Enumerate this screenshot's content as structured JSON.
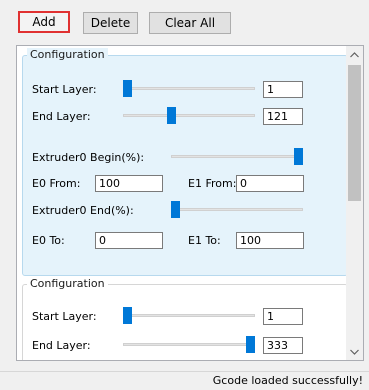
{
  "toolbar": {
    "add_label": "Add",
    "delete_label": "Delete",
    "clear_all_label": "Clear All"
  },
  "configurations": [
    {
      "title": "Configuration",
      "selected": true,
      "start_layer_label": "Start Layer:",
      "start_layer_value": "1",
      "start_layer_slider_fraction": 0.0,
      "end_layer_label": "End Layer:",
      "end_layer_value": "121",
      "end_layer_slider_fraction": 0.36,
      "extruder_begin_label": "Extruder0 Begin(%):",
      "extruder_begin_slider_fraction": 1.0,
      "e0_from_label": "E0 From:",
      "e0_from_value": "100",
      "e1_from_label": "E1 From:",
      "e1_from_value": "0",
      "extruder_end_label": "Extruder0 End(%):",
      "extruder_end_slider_fraction": 0.0,
      "e0_to_label": "E0 To:",
      "e0_to_value": "0",
      "e1_to_label": "E1 To:",
      "e1_to_value": "100"
    },
    {
      "title": "Configuration",
      "selected": false,
      "start_layer_label": "Start Layer:",
      "start_layer_value": "1",
      "start_layer_slider_fraction": 0.0,
      "end_layer_label": "End Layer:",
      "end_layer_value": "333",
      "end_layer_slider_fraction": 1.0
    }
  ],
  "scrollbar": {
    "up_icon": "chevron-up-icon",
    "down_icon": "chevron-down-icon"
  },
  "status": {
    "message": "Gcode loaded successfully!"
  },
  "colors": {
    "accent": "#0078d7",
    "selected_bg": "#e5f3fb",
    "focus_border": "#e03131"
  }
}
